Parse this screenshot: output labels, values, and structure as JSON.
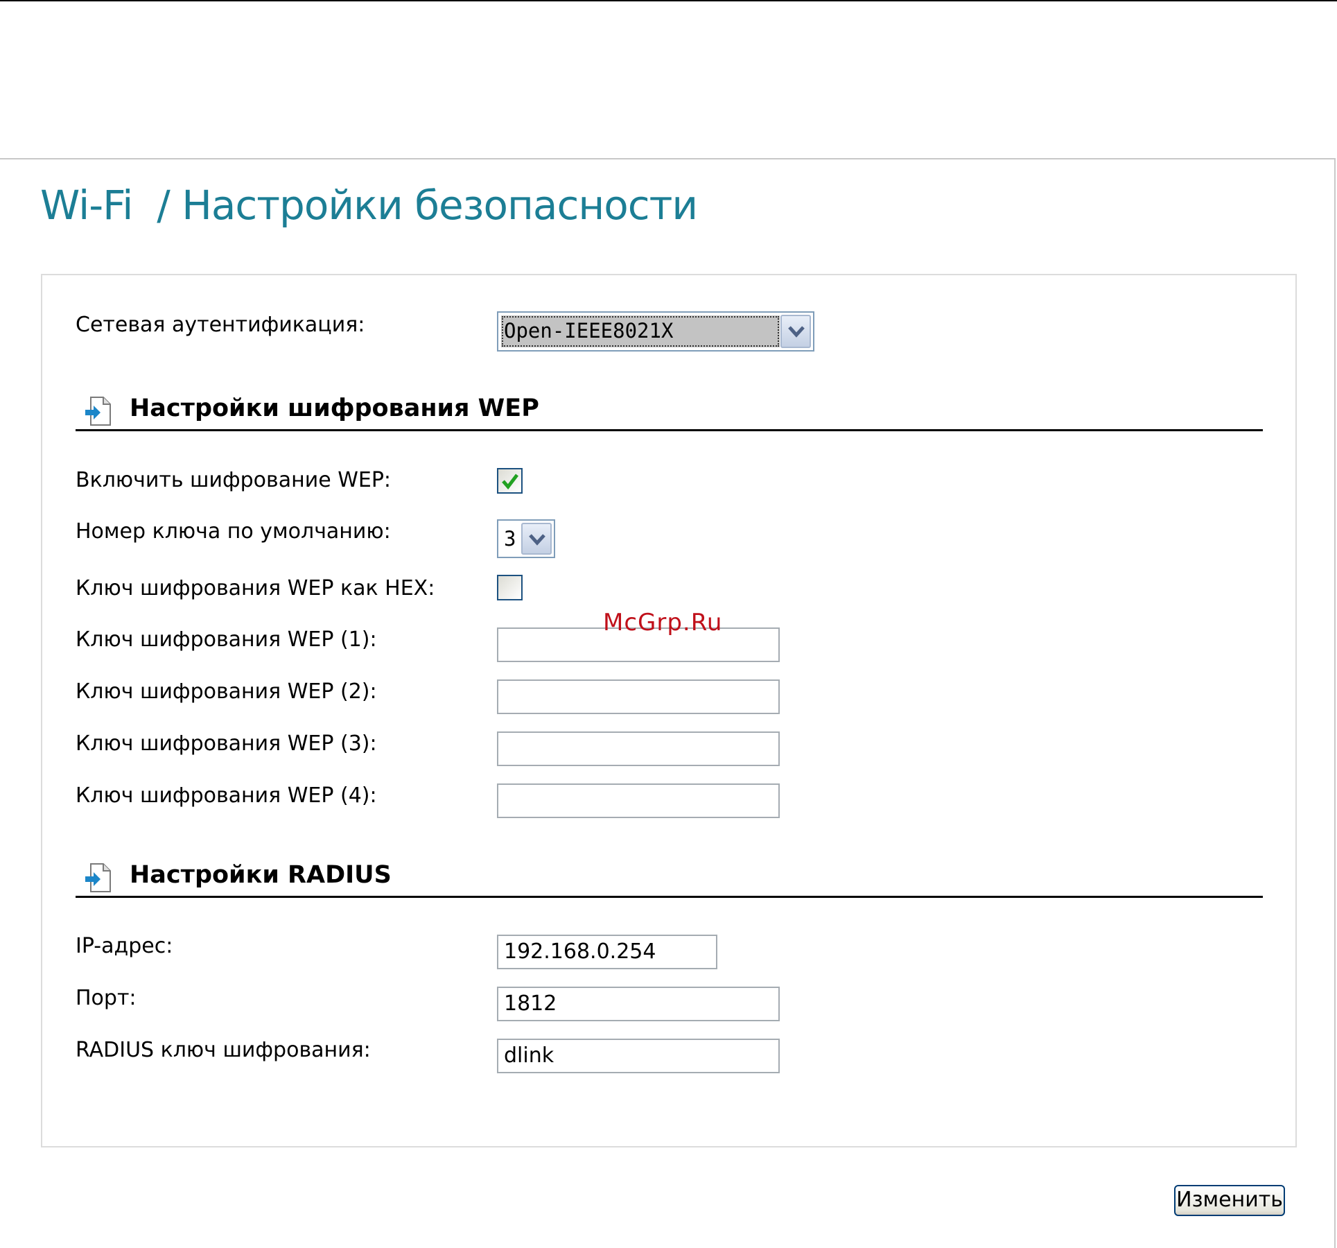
{
  "page": {
    "title": "Wi-Fi  / Настройки безопасности"
  },
  "auth": {
    "label": "Сетевая аутентификация:",
    "value": "Open-IEEE8021X"
  },
  "wep": {
    "section_title": "Настройки шифрования WEP",
    "enable_label": "Включить шифрование WEP:",
    "enable_checked": true,
    "default_key_label": "Номер ключа по умолчанию:",
    "default_key_value": "3",
    "hex_label": "Ключ шифрования WEP как HEX:",
    "hex_checked": false,
    "keys": [
      {
        "label": "Ключ шифрования WEP (1):",
        "value": ""
      },
      {
        "label": "Ключ шифрования WEP (2):",
        "value": ""
      },
      {
        "label": "Ключ шифрования WEP (3):",
        "value": ""
      },
      {
        "label": "Ключ шифрования WEP (4):",
        "value": ""
      }
    ]
  },
  "radius": {
    "section_title": "Настройки RADIUS",
    "ip_label": "IP-адрес:",
    "ip_value": "192.168.0.254",
    "port_label": "Порт:",
    "port_value": "1812",
    "key_label": "RADIUS ключ шифрования:",
    "key_value": "dlink"
  },
  "watermark": "McGrp.Ru",
  "actions": {
    "apply_label": "Изменить"
  },
  "colors": {
    "title": "#1c7e95",
    "check": "#21a121",
    "watermark": "#c0101a"
  }
}
